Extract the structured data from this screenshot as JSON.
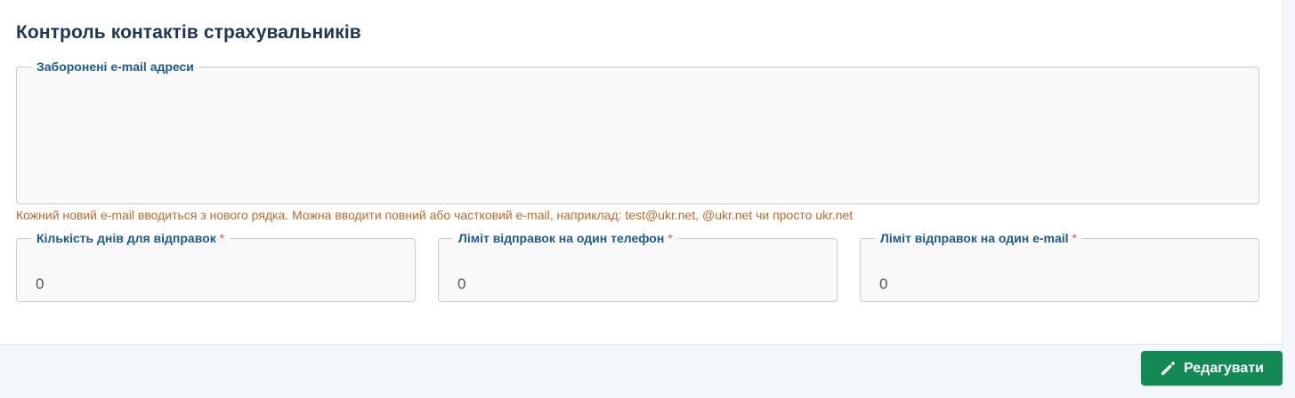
{
  "page": {
    "title": "Контроль контактів страхувальників"
  },
  "form": {
    "forbidden_emails": {
      "label": "Заборонені e-mail адреси",
      "value": "",
      "hint": "Кожний новий e-mail вводиться з нового рядка. Можна вводити повний або частковий e-mail, наприклад: test@ukr.net, @ukr.net чи просто ukr.net"
    },
    "days_count": {
      "label": "Кількість днів для відправок",
      "required_mark": "*",
      "value": "0"
    },
    "phone_limit": {
      "label": "Ліміт відправок на один телефон",
      "required_mark": "*",
      "value": "0"
    },
    "email_limit": {
      "label": "Ліміт відправок на один e-mail",
      "required_mark": "*",
      "value": "0"
    }
  },
  "actions": {
    "edit_label": "Редагувати",
    "edit_icon": "pencil-icon"
  },
  "colors": {
    "title": "#1f3550",
    "legend": "#1e5a8c",
    "hint": "#c0692a",
    "required": "#d9534f",
    "button": "#138a55",
    "background": "#f3f6fb"
  }
}
